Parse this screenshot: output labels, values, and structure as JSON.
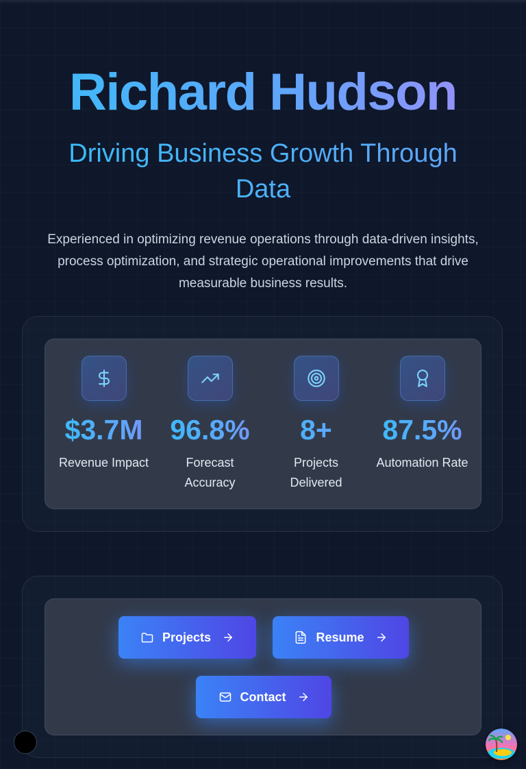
{
  "hero": {
    "name": "Richard Hudson",
    "tagline": "Driving Business Growth Through Data",
    "description": "Experienced in optimizing revenue operations through data-driven insights, process optimization, and strategic operational improvements that drive measurable business results."
  },
  "stats": [
    {
      "icon": "dollar-icon",
      "value": "$3.7M",
      "label": "Revenue Impact"
    },
    {
      "icon": "trending-up-icon",
      "value": "96.8%",
      "label": "Forecast Accuracy"
    },
    {
      "icon": "target-icon",
      "value": "8+",
      "label": "Projects Delivered"
    },
    {
      "icon": "award-icon",
      "value": "87.5%",
      "label": "Automation Rate"
    }
  ],
  "nav": {
    "projects_label": "Projects",
    "resume_label": "Resume",
    "contact_label": "Contact"
  },
  "colors": {
    "background": "#0f172a",
    "accent_blue": "#3b82f6",
    "accent_indigo": "#4f46e5",
    "gradient_cyan": "#38bdf8",
    "gradient_violet": "#a78bfa"
  }
}
